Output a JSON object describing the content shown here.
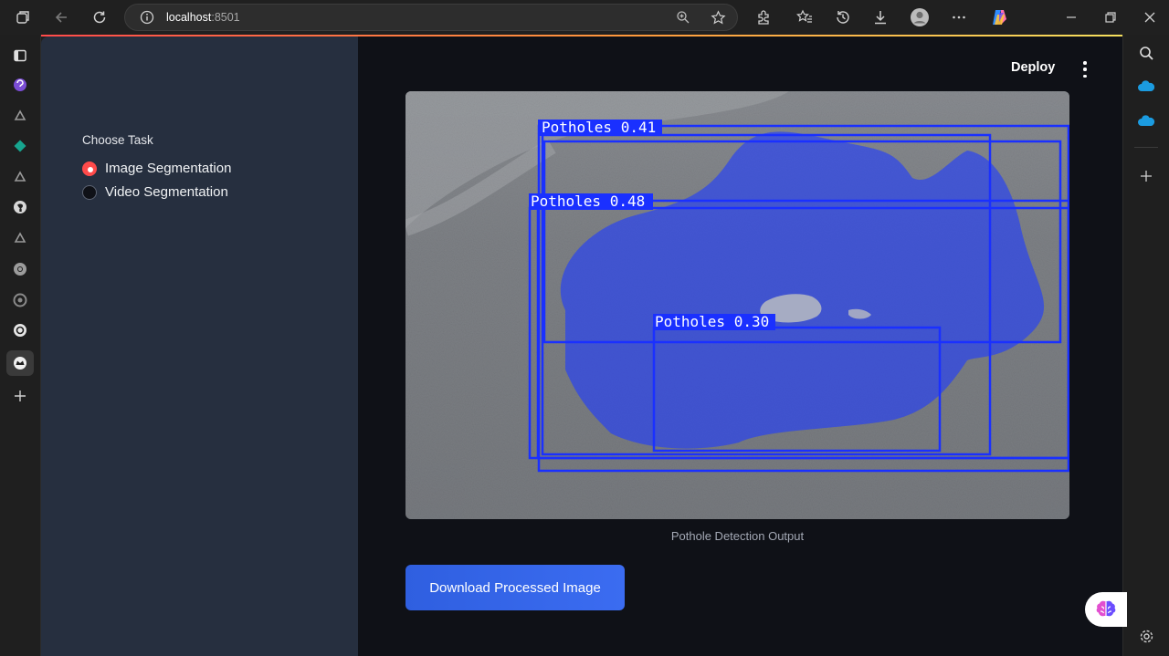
{
  "browser": {
    "url_host": "localhost",
    "url_port": ":8501"
  },
  "sidebar": {
    "choose_task_label": "Choose Task",
    "options": [
      {
        "label": "Image Segmentation",
        "selected": true
      },
      {
        "label": "Video Segmentation",
        "selected": false
      }
    ]
  },
  "header": {
    "deploy_label": "Deploy"
  },
  "main": {
    "detections": [
      {
        "label": "Potholes 0.41"
      },
      {
        "label": "Potholes 0.48"
      },
      {
        "label": "Potholes 0.30"
      }
    ],
    "caption": "Pothole Detection Output",
    "download_button": "Download Processed Image"
  },
  "colors": {
    "accent_red": "#ff4b4b",
    "detection_blue": "#1f3cff",
    "button_blue": "#3b6cf1"
  }
}
